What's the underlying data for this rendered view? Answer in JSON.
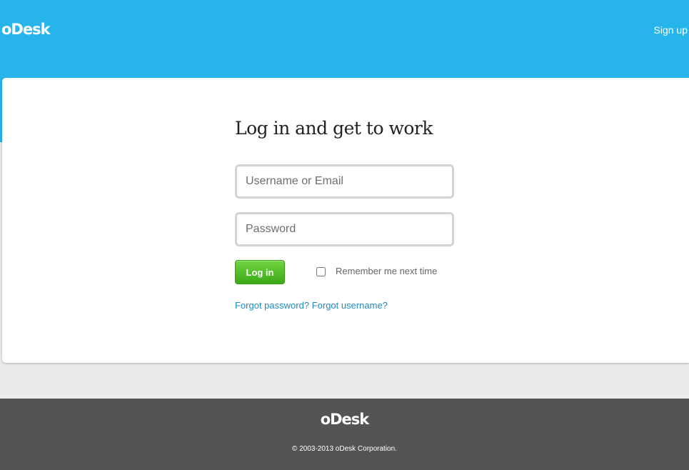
{
  "header": {
    "logo_text": "oDesk",
    "signup_label": "Sign up"
  },
  "login": {
    "title": "Log in and get to work",
    "username": {
      "placeholder": "Username or Email",
      "value": ""
    },
    "password": {
      "placeholder": "Password",
      "value": ""
    },
    "login_button_label": "Log in",
    "remember_label": "Remember me next time",
    "remember_checked": false,
    "forgot_password_label": "Forgot password?",
    "forgot_username_label": "Forgot username?"
  },
  "footer": {
    "logo_text": "oDesk",
    "copyright": "© 2003-2013 oDesk Corporation."
  },
  "colors": {
    "header_blue": "#27b4eb",
    "button_green": "#4fbf27",
    "link_blue": "#1f8ac0",
    "footer_gray": "#545454",
    "page_gray": "#ebebeb"
  }
}
